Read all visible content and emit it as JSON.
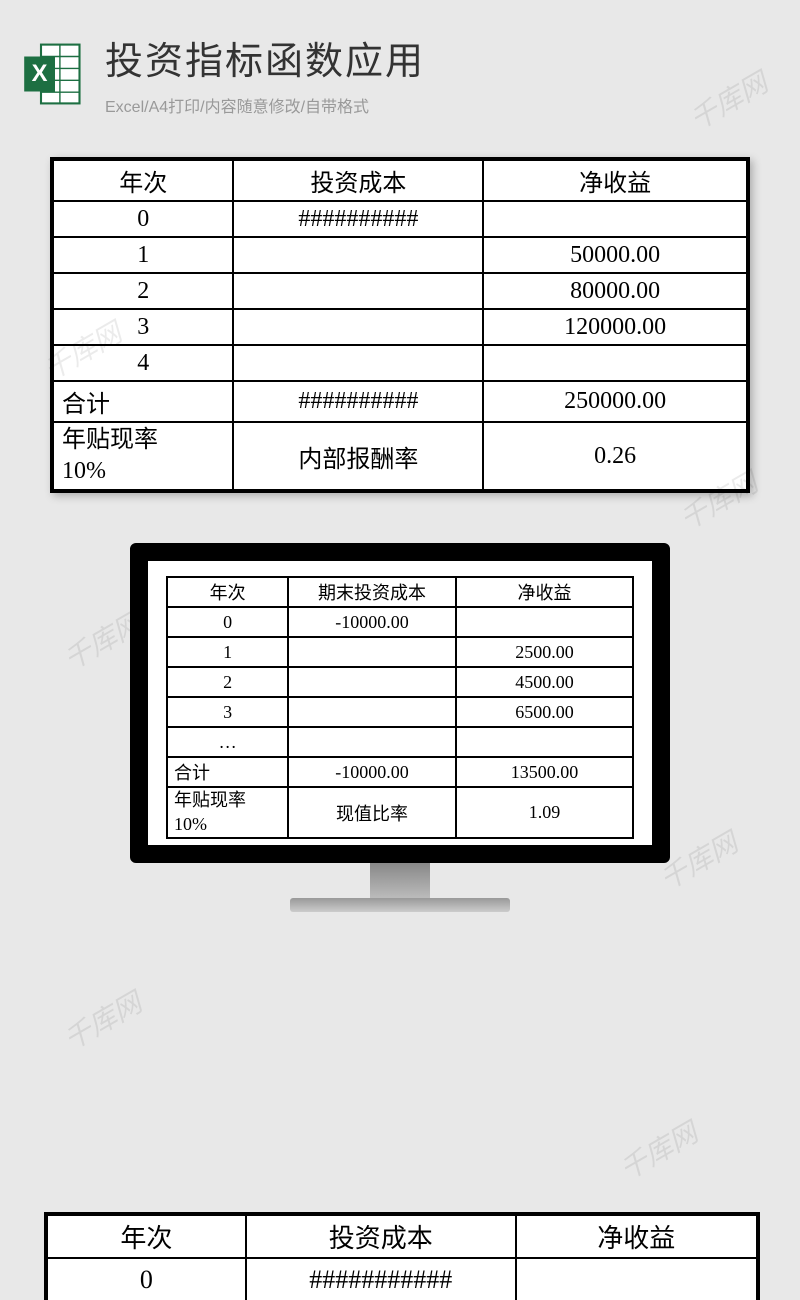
{
  "watermark_text": "千库网",
  "header": {
    "title": "投资指标函数应用",
    "subtitle": "Excel/A4打印/内容随意修改/自带格式",
    "icon_letter": "X"
  },
  "table1": {
    "headers": [
      "年次",
      "投资成本",
      "净收益"
    ],
    "rows": [
      {
        "year": "0",
        "cost": "##########",
        "income": ""
      },
      {
        "year": "1",
        "cost": "",
        "income": "50000.00"
      },
      {
        "year": "2",
        "cost": "",
        "income": "80000.00"
      },
      {
        "year": "3",
        "cost": "",
        "income": "120000.00"
      },
      {
        "year": "4",
        "cost": "",
        "income": ""
      }
    ],
    "total_label": "合计",
    "total_cost": "##########",
    "total_income": "250000.00",
    "rate_label_line1": "年贴现率",
    "rate_label_line2": "10%",
    "rate_mid_label": "内部报酬率",
    "rate_value": "0.26"
  },
  "table2": {
    "headers": [
      "年次",
      "期末投资成本",
      "净收益"
    ],
    "rows": [
      {
        "year": "0",
        "cost": "-10000.00",
        "income": ""
      },
      {
        "year": "1",
        "cost": "",
        "income": "2500.00"
      },
      {
        "year": "2",
        "cost": "",
        "income": "4500.00"
      },
      {
        "year": "3",
        "cost": "",
        "income": "6500.00"
      },
      {
        "year": "…",
        "cost": "",
        "income": ""
      }
    ],
    "total_label": "合计",
    "total_cost": "-10000.00",
    "total_income": "13500.00",
    "rate_label_line1": "年贴现率",
    "rate_label_line2": "10%",
    "rate_mid_label": "现值比率",
    "rate_value": "1.09"
  },
  "table3": {
    "headers": [
      "年次",
      "投资成本",
      "净收益"
    ],
    "row": {
      "year": "0",
      "cost": "###########",
      "income": ""
    }
  }
}
